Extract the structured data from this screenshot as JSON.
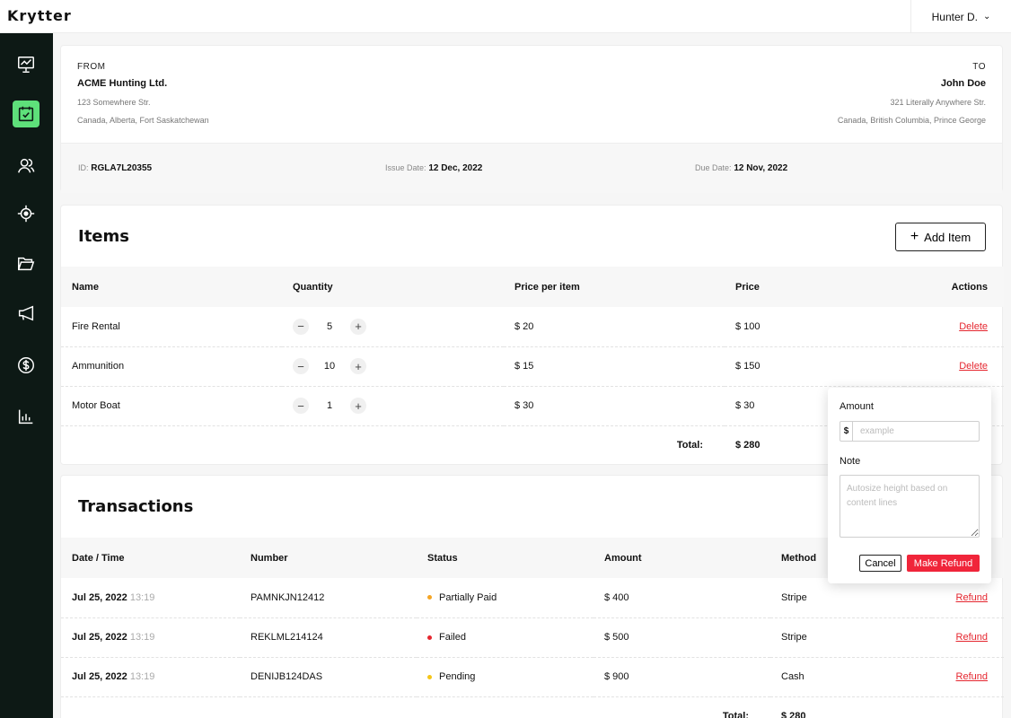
{
  "app": {
    "logo": "Krytter",
    "user_name": "Hunter D."
  },
  "sidebar": {
    "items": [
      {
        "icon": "presentation-chart-icon",
        "active": false
      },
      {
        "icon": "calendar-check-icon",
        "active": true
      },
      {
        "icon": "users-icon",
        "active": false
      },
      {
        "icon": "crosshair-icon",
        "active": false
      },
      {
        "icon": "folder-open-icon",
        "active": false
      },
      {
        "icon": "megaphone-icon",
        "active": false
      },
      {
        "icon": "dollar-circle-icon",
        "active": false
      },
      {
        "icon": "bar-chart-icon",
        "active": false
      }
    ],
    "accent_color": "#5ee07a",
    "background_color": "#0d1915"
  },
  "invoice": {
    "from_label": "FROM",
    "from_name": "ACME Hunting Ltd.",
    "from_address_line1": "123 Somewhere Str.",
    "from_address_line2": "Canada, Alberta, Fort Saskatchewan",
    "to_label": "TO",
    "to_name": "John Doe",
    "to_address_line1": "321 Literally Anywhere Str.",
    "to_address_line2": "Canada, British Columbia, Prince George",
    "id_label": "ID:",
    "id_value": "RGLA7L20355",
    "issue_label": "Issue Date:",
    "issue_value": "12 Dec, 2022",
    "due_label": "Due Date:",
    "due_value": "12 Nov, 2022"
  },
  "items": {
    "title": "Items",
    "add_button_label": "Add Item",
    "columns": [
      "Name",
      "Quantity",
      "Price per item",
      "Price",
      "Actions"
    ],
    "rows": [
      {
        "name": "Fire Rental",
        "quantity": "5",
        "unit_price": "$ 20",
        "price": "$ 100",
        "action": "Delete"
      },
      {
        "name": "Ammunition",
        "quantity": "10",
        "unit_price": "$ 15",
        "price": "$ 150",
        "action": "Delete"
      },
      {
        "name": "Motor Boat",
        "quantity": "1",
        "unit_price": "$ 30",
        "price": "$ 30",
        "action": ""
      }
    ],
    "total_label": "Total:",
    "total_value": "$ 280"
  },
  "transactions": {
    "title": "Transactions",
    "columns": [
      "Date / Time",
      "Number",
      "Status",
      "Amount",
      "Method"
    ],
    "rows": [
      {
        "date": "Jul 25, 2022",
        "time": "13:19",
        "number": "PAMNKJN12412",
        "status": "Partially Paid",
        "status_color": "#f5a524",
        "amount": "$ 400",
        "method": "Stripe",
        "action": "Refund"
      },
      {
        "date": "Jul 25, 2022",
        "time": "13:19",
        "number": "REKLML214124",
        "status": "Failed",
        "status_color": "#e5262f",
        "amount": "$ 500",
        "method": "Stripe",
        "action": "Refund"
      },
      {
        "date": "Jul 25, 2022",
        "time": "13:19",
        "number": "DENIJB124DAS",
        "status": "Pending",
        "status_color": "#f5c518",
        "amount": "$ 900",
        "method": "Cash",
        "action": "Refund"
      }
    ],
    "total_label": "Total:",
    "total_value": "$ 280"
  },
  "refund_popover": {
    "amount_label": "Amount",
    "currency_symbol": "$",
    "amount_placeholder": "example",
    "note_label": "Note",
    "note_placeholder": "Autosize height based on content lines",
    "cancel_label": "Cancel",
    "submit_label": "Make Refund",
    "submit_color": "#f0253a"
  }
}
